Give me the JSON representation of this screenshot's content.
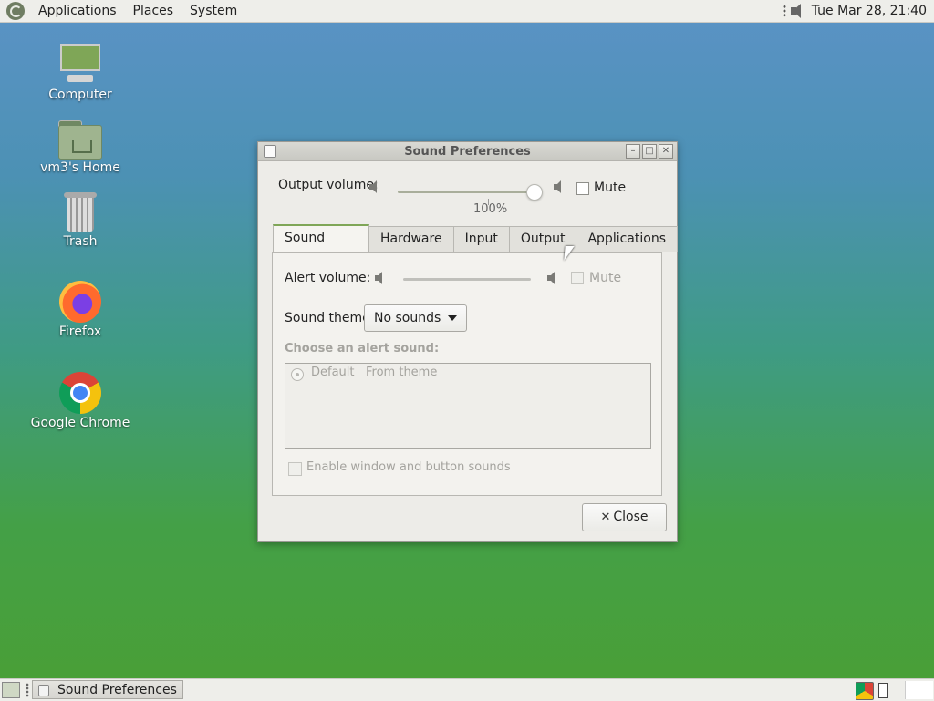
{
  "top_panel": {
    "menus": [
      "Applications",
      "Places",
      "System"
    ],
    "clock": "Tue Mar 28, 21:40"
  },
  "desktop": {
    "icons": [
      {
        "label": "Computer",
        "icon": "computer-icon"
      },
      {
        "label": "vm3's Home",
        "icon": "home-folder-icon"
      },
      {
        "label": "Trash",
        "icon": "trash-icon"
      },
      {
        "label": "Firefox",
        "icon": "firefox-icon"
      },
      {
        "label": "Google Chrome",
        "icon": "chrome-icon"
      }
    ]
  },
  "window": {
    "title": "Sound Preferences",
    "output_volume": {
      "label": "Output volume:",
      "value_text": "100%",
      "level": 1.0,
      "mute_label": "Mute",
      "muted": false
    },
    "tabs": [
      "Sound Effects",
      "Hardware",
      "Input",
      "Output",
      "Applications"
    ],
    "active_tab": "Sound Effects",
    "sound_effects": {
      "alert_volume_label": "Alert volume:",
      "alert_mute_label": "Mute",
      "sound_theme_label": "Sound theme:",
      "sound_theme_value": "No sounds",
      "choose_alert_label": "Choose an alert sound:",
      "alert_sounds": [
        {
          "name": "Default",
          "source": "From theme"
        }
      ],
      "enable_sounds_label": "Enable window and button sounds"
    },
    "close_label": "Close"
  },
  "bottom_panel": {
    "tasks": [
      "Sound Preferences"
    ]
  },
  "colors": {
    "accent": "#7fa657",
    "panel": "#eeeeea",
    "window_bg": "#edece8"
  }
}
